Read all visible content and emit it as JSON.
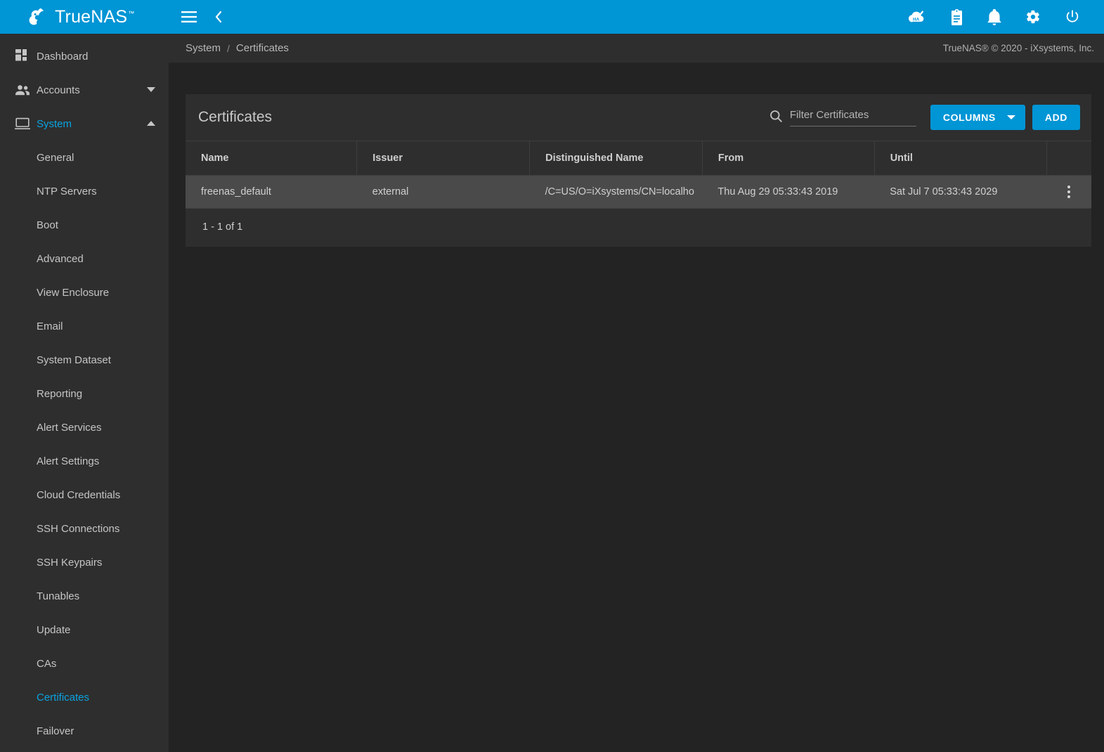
{
  "brand": {
    "name": "TrueNAS",
    "trademark": "™",
    "logo_icon": "truenas-logo-icon"
  },
  "topbar": {
    "menu_icon": "hamburger-menu-icon",
    "collapse_icon": "chevron-left-icon",
    "accent_color": "#0095d5",
    "actions": [
      {
        "icon": "ha-status-cloud-check-icon",
        "name": "ha-status-button"
      },
      {
        "icon": "clipboard-tasks-icon",
        "name": "task-manager-button"
      },
      {
        "icon": "bell-notifications-icon",
        "name": "notifications-button"
      },
      {
        "icon": "gear-settings-icon",
        "name": "settings-button"
      },
      {
        "icon": "power-icon",
        "name": "power-button"
      }
    ]
  },
  "breadcrumb": {
    "items": [
      "System",
      "Certificates"
    ],
    "separator": "/",
    "copyright": "TrueNAS® © 2020 - iXsystems, Inc."
  },
  "sidebar": {
    "items": [
      {
        "label": "Dashboard",
        "icon": "dashboard-grid-icon",
        "type": "top",
        "expandable": false,
        "active": false
      },
      {
        "label": "Accounts",
        "icon": "people-icon",
        "type": "top",
        "expandable": true,
        "expanded": false,
        "active": false
      },
      {
        "label": "System",
        "icon": "monitor-icon",
        "type": "top",
        "expandable": true,
        "expanded": true,
        "active": true
      }
    ],
    "sub_items": [
      {
        "label": "General",
        "active": false
      },
      {
        "label": "NTP Servers",
        "active": false
      },
      {
        "label": "Boot",
        "active": false
      },
      {
        "label": "Advanced",
        "active": false
      },
      {
        "label": "View Enclosure",
        "active": false
      },
      {
        "label": "Email",
        "active": false
      },
      {
        "label": "System Dataset",
        "active": false
      },
      {
        "label": "Reporting",
        "active": false
      },
      {
        "label": "Alert Services",
        "active": false
      },
      {
        "label": "Alert Settings",
        "active": false
      },
      {
        "label": "Cloud Credentials",
        "active": false
      },
      {
        "label": "SSH Connections",
        "active": false
      },
      {
        "label": "SSH Keypairs",
        "active": false
      },
      {
        "label": "Tunables",
        "active": false
      },
      {
        "label": "Update",
        "active": false
      },
      {
        "label": "CAs",
        "active": false
      },
      {
        "label": "Certificates",
        "active": true
      },
      {
        "label": "Failover",
        "active": false
      }
    ],
    "active_color": "#0aa3e0"
  },
  "card": {
    "title": "Certificates",
    "search": {
      "placeholder": "Filter Certificates",
      "value": "",
      "icon": "search-icon"
    },
    "columns_button": {
      "label": "COLUMNS",
      "caret_icon": "chevron-down-icon"
    },
    "add_button": {
      "label": "ADD"
    }
  },
  "table": {
    "headers": [
      "Name",
      "Issuer",
      "Distinguished Name",
      "From",
      "Until",
      ""
    ],
    "rows": [
      {
        "name": "freenas_default",
        "issuer": "external",
        "distinguished_name": "/C=US/O=iXsystems/CN=localho",
        "from": "Thu Aug 29 05:33:43 2019",
        "until": "Sat Jul 7 05:33:43 2029",
        "actions_icon": "kebab-menu-icon"
      }
    ],
    "footer": "1 - 1 of 1"
  }
}
